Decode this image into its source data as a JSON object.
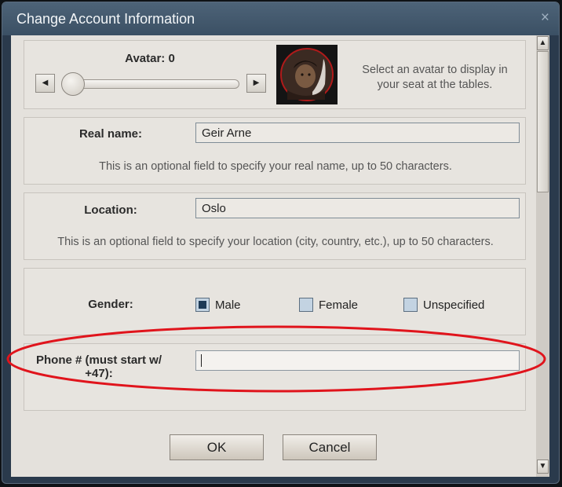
{
  "dialog": {
    "title": "Change Account Information",
    "close_icon": "×"
  },
  "avatar": {
    "label": "Avatar: 0",
    "value": 0,
    "left_arrow": "◀",
    "right_arrow": "▶",
    "help": "Select an avatar to display in your seat at the tables."
  },
  "real_name": {
    "label": "Real name:",
    "value": "Geir Arne",
    "help": "This is an optional field to specify your real name, up to 50 characters."
  },
  "location": {
    "label": "Location:",
    "value": "Oslo",
    "help": "This is an optional field to specify your location (city, country, etc.), up to 50 characters."
  },
  "gender": {
    "label": "Gender:",
    "options": [
      "Male",
      "Female",
      "Unspecified"
    ],
    "selected": "Male"
  },
  "phone": {
    "label": "Phone # (must start w/ +47):",
    "value": ""
  },
  "buttons": {
    "ok": "OK",
    "cancel": "Cancel"
  },
  "scrollbar": {
    "up": "▲",
    "down": "▼"
  },
  "colors": {
    "highlight_ellipse": "#e0141c"
  }
}
